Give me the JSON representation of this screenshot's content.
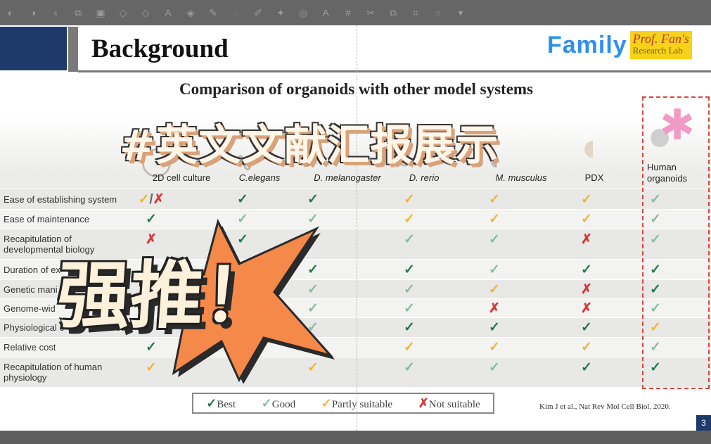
{
  "toolbar": {
    "icons": [
      "sound-icon",
      "sound-icon",
      "bulb-icon",
      "copy-icon",
      "image-icon",
      "shape-icon",
      "shape2-icon",
      "text-icon",
      "fill-icon",
      "pen-icon",
      "effect-icon",
      "brush-icon",
      "pin-icon",
      "circle-icon",
      "text-size-icon",
      "grid-icon",
      "select-icon",
      "group-icon",
      "crop-icon",
      "record-icon",
      "more-icon"
    ]
  },
  "slide": {
    "title": "Background",
    "logo": {
      "family": "Family",
      "prof": "Prof. Fan's",
      "lab": "Research Lab"
    },
    "subtitle": "Comparison of organoids with other model systems",
    "columns": [
      "2D cell culture",
      "C.elegans",
      "D. melanogaster",
      "D. rerio",
      "M. musculus",
      "PDX",
      "Human organoids"
    ],
    "rows": [
      {
        "label": "Ease of establishing system",
        "marks": [
          "partly/not",
          "best",
          "best",
          "partly",
          "partly",
          "partly",
          "good"
        ]
      },
      {
        "label": "Ease of maintenance",
        "marks": [
          "best",
          "good",
          "good",
          "partly",
          "partly",
          "partly",
          "good"
        ]
      },
      {
        "label": "Recapitulation of developmental biology",
        "marks": [
          "not",
          "best",
          "good",
          "good",
          "good",
          "not",
          "good"
        ]
      },
      {
        "label": "Duration of ex",
        "marks": [
          "",
          "",
          "best",
          "best",
          "good",
          "best",
          "best"
        ]
      },
      {
        "label": "Genetic mani",
        "marks": [
          "",
          "",
          "good",
          "good",
          "partly",
          "not",
          "best"
        ]
      },
      {
        "label": "Genome-wid",
        "marks": [
          "",
          "",
          "good",
          "good",
          "not",
          "not",
          "good"
        ]
      },
      {
        "label": "Physiological c",
        "marks": [
          "",
          "",
          "good",
          "best",
          "best",
          "best",
          "partly"
        ]
      },
      {
        "label": "Relative cost",
        "marks": [
          "best",
          "",
          "",
          "partly",
          "partly",
          "partly",
          "good"
        ]
      },
      {
        "label": "Recapitulation of human physiology",
        "marks": [
          "partly",
          "",
          "partly",
          "good",
          "good",
          "best",
          "best"
        ]
      }
    ],
    "legend": [
      {
        "key": "best",
        "label": "Best"
      },
      {
        "key": "good",
        "label": "Good"
      },
      {
        "key": "partly",
        "label": "Partly suitable"
      },
      {
        "key": "not",
        "label": "Not suitable"
      }
    ],
    "citation": "Kim J et al., Nat Rev Mol Cell Biol. 2020.",
    "page_number": "3"
  },
  "overlay": {
    "title": "#英文文献汇报展示",
    "badge": "强推！"
  },
  "colors": {
    "best": "#1f7a4c",
    "good": "#86bda0",
    "partly": "#f2b530",
    "not": "#d9383a",
    "navy": "#1d3a6b",
    "star": "#f5894a",
    "highlight_box": "#e0433b"
  }
}
